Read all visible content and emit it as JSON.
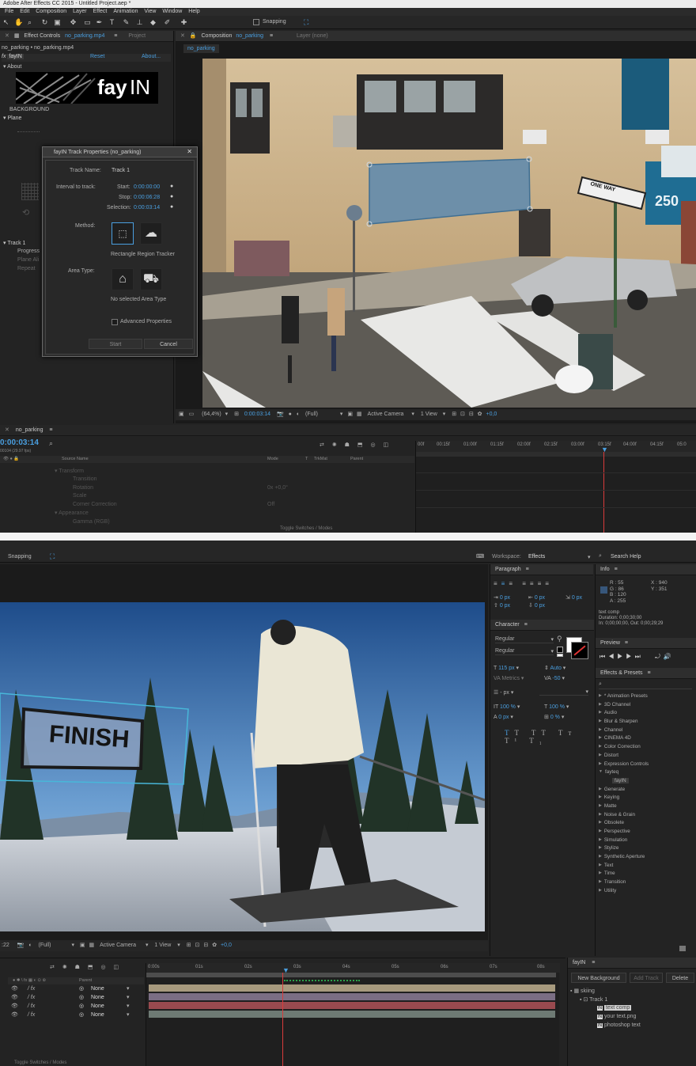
{
  "top": {
    "window_title": "Adobe After Effects CC 2015 - Untitled Project.aep *",
    "menu": [
      "File",
      "Edit",
      "Composition",
      "Layer",
      "Effect",
      "Animation",
      "View",
      "Window",
      "Help"
    ],
    "snapping": "Snapping",
    "effect_controls": {
      "tab_label": "Effect Controls",
      "tab_file": "no_parking.mp4",
      "project_tab": "Project",
      "breadcrumb": "no_parking • no_parking.mp4",
      "fx_name": "fayIN",
      "reset": "Reset",
      "about": "About...",
      "about_group": "About",
      "logo_text_bold": "fay",
      "logo_text_light": "IN",
      "background": "BACKGROUND",
      "plane": "Plane",
      "track1": "Track 1",
      "progress": "Progress",
      "track_items": [
        "Plane Ali",
        "Repeat"
      ]
    },
    "dialog": {
      "title": "fayIN Track Properties (no_parking)",
      "track_name_label": "Track Name:",
      "track_name_value": "Track 1",
      "interval_label": "Interval to track:",
      "start_label": "Start:",
      "start_value": "0:00:00:00",
      "stop_label": "Stop:",
      "stop_value": "0:00:06:28",
      "selection_label": "Selection:",
      "selection_value": "0:00:03:14",
      "method_label": "Method:",
      "method_caption": "Rectangle Region Tracker",
      "area_type_label": "Area Type:",
      "area_caption": "No selected Area Type",
      "advanced": "Advanced Properties",
      "start_btn": "Start",
      "cancel_btn": "Cancel"
    },
    "composition": {
      "tab_label": "Composition",
      "tab_name": "no_parking",
      "layer_tab": "Layer (none)",
      "subtab": "no_parking",
      "zoom": "(64,4%)",
      "timecode": "0:00:03:14",
      "resolution": "(Full)",
      "camera": "Active Camera",
      "view": "1 View",
      "exposure": "+0,0",
      "sign_number": "250",
      "street_sign": "ONE WAY"
    },
    "timeline": {
      "comp_name": "no_parking",
      "timecode": "0:00:03:14",
      "frames": "00104 (29.97 fps)",
      "cols": [
        "Source Name",
        "Mode",
        "T",
        "TrkMat",
        "Parent"
      ],
      "rows": [
        {
          "name": "Transform",
          "val": ""
        },
        {
          "name": "Transition",
          "val": ""
        },
        {
          "name": "Rotation",
          "val": "0x +0,0°"
        },
        {
          "name": "Scale",
          "val": ""
        },
        {
          "name": "Corner Correction",
          "val": "Off"
        },
        {
          "name": "Appearance",
          "val": ""
        },
        {
          "name": "Gamma (RGB)",
          "val": ""
        }
      ],
      "ruler": [
        "00f",
        "00:15f",
        "01:00f",
        "01:15f",
        "02:00f",
        "02:15f",
        "03:00f",
        "03:15f",
        "04:00f",
        "04:15f",
        "05:0"
      ],
      "toggle": "Toggle Switches / Modes"
    }
  },
  "bottom": {
    "snapping": "Snapping",
    "workspace_label": "Workspace:",
    "workspace_value": "Effects",
    "search_help": "Search Help",
    "overlay_text": "FINISH",
    "paragraph": {
      "title": "Paragraph",
      "values": [
        "0 px",
        "0 px",
        "0 px",
        "0 px",
        "0 px"
      ]
    },
    "character": {
      "title": "Character",
      "font": "Regular",
      "style": "Regular",
      "size": "115 px",
      "leading": "Auto",
      "kerning": "Metrics",
      "tracking": "-50",
      "stroke": "- px",
      "vscale": "100 %",
      "hscale": "100 %",
      "baseline": "0 px",
      "tsume": "0 %"
    },
    "info": {
      "title": "Info",
      "r": "R : 55",
      "g": "G : 86",
      "b": "B : 120",
      "a": "A : 255",
      "x": "X : 940",
      "y": "Y : 351",
      "layer": "text comp",
      "duration": "Duration: 0;00;30;00",
      "inout": "In: 0;00;00;00, Out: 0;00;29;29"
    },
    "preview": {
      "title": "Preview"
    },
    "effects_presets": {
      "title": "Effects & Presets",
      "items": [
        {
          "label": "* Animation Presets",
          "type": "closed"
        },
        {
          "label": "3D Channel",
          "type": "closed"
        },
        {
          "label": "Audio",
          "type": "closed"
        },
        {
          "label": "Blur & Sharpen",
          "type": "closed"
        },
        {
          "label": "Channel",
          "type": "closed"
        },
        {
          "label": "CINEMA 4D",
          "type": "closed"
        },
        {
          "label": "Color Correction",
          "type": "closed"
        },
        {
          "label": "Distort",
          "type": "closed"
        },
        {
          "label": "Expression Controls",
          "type": "closed"
        },
        {
          "label": "fayteq",
          "type": "open"
        },
        {
          "label": "fayIN",
          "type": "child"
        },
        {
          "label": "Generate",
          "type": "closed"
        },
        {
          "label": "Keying",
          "type": "closed"
        },
        {
          "label": "Matte",
          "type": "closed"
        },
        {
          "label": "Noise & Grain",
          "type": "closed"
        },
        {
          "label": "Obsolete",
          "type": "closed"
        },
        {
          "label": "Perspective",
          "type": "closed"
        },
        {
          "label": "Simulation",
          "type": "closed"
        },
        {
          "label": "Stylize",
          "type": "closed"
        },
        {
          "label": "Synthetic Aperture",
          "type": "closed"
        },
        {
          "label": "Text",
          "type": "closed"
        },
        {
          "label": "Time",
          "type": "closed"
        },
        {
          "label": "Transition",
          "type": "closed"
        },
        {
          "label": "Utility",
          "type": "closed"
        }
      ]
    },
    "viewer_bar": {
      "timecode": ":22",
      "resolution": "(Full)",
      "camera": "Active Camera",
      "view": "1 View",
      "exposure": "+0,0"
    },
    "timeline": {
      "parent_col": "Parent",
      "parents": [
        "None",
        "None",
        "None",
        "None"
      ],
      "ruler": [
        "0:00s",
        "01s",
        "02s",
        "03s",
        "04s",
        "05s",
        "06s",
        "07s",
        "08s"
      ],
      "toggle": "Toggle Switches / Modes"
    },
    "fayin_panel": {
      "title": "fayIN",
      "new_bg": "New Background",
      "add_track": "Add Track",
      "delete": "Delete",
      "tree_root": "skiing",
      "tree_track": "Track 1",
      "tree_items": [
        "text comp",
        "your text.png",
        "photoshop text"
      ]
    }
  }
}
